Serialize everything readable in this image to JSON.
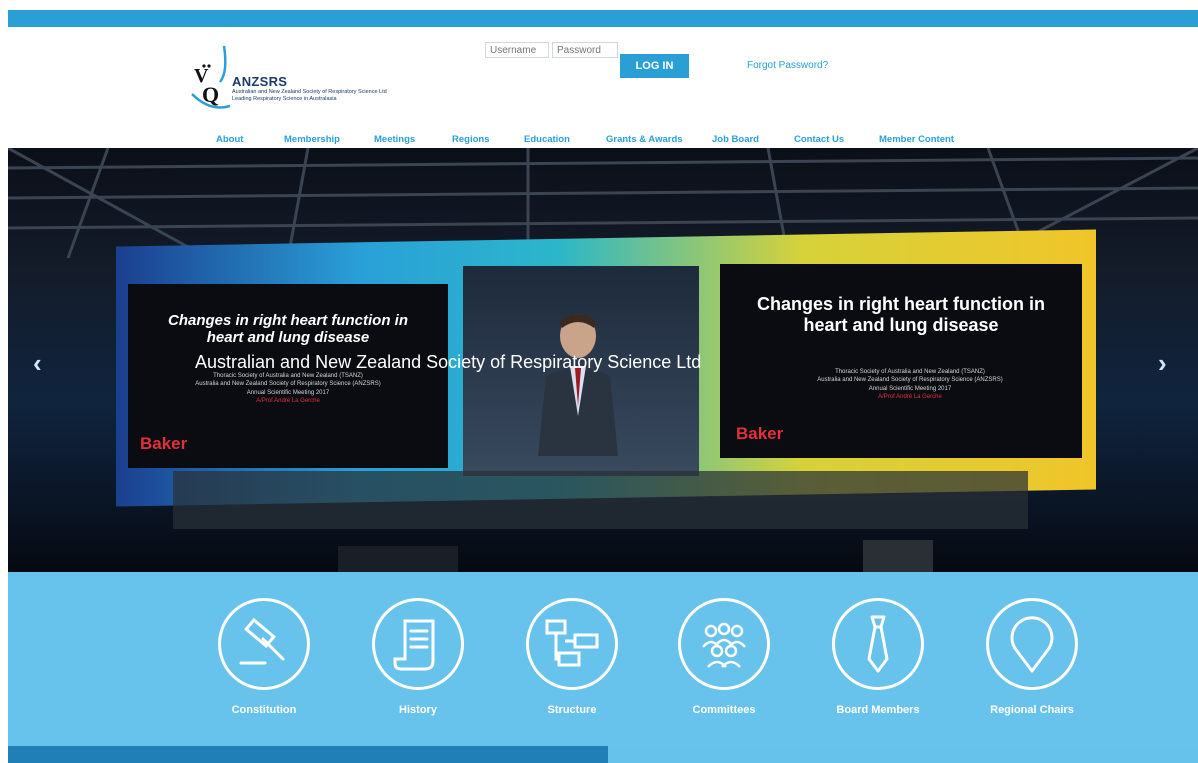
{
  "colors": {
    "brand_blue": "#2a9fd6",
    "feature_bg": "#68c3ec",
    "logo_navy": "#1d3a6b",
    "baker_red": "#e0313b"
  },
  "header": {
    "logo_name": "ANZSRS",
    "logo_sub1": "Australian and New Zealand Society of Respiratory Science Ltd",
    "logo_sub2": "Leading Respiratory Science in Australasia",
    "logo_icon": "vq-logo-icon"
  },
  "login": {
    "username_placeholder": "Username",
    "password_placeholder": "Password",
    "button_label": "LOG IN",
    "forgot_label": "Forgot Password?"
  },
  "nav": {
    "items": [
      {
        "label": "About"
      },
      {
        "label": "Membership"
      },
      {
        "label": "Meetings"
      },
      {
        "label": "Regions"
      },
      {
        "label": "Education"
      },
      {
        "label": "Grants & Awards"
      },
      {
        "label": "Job Board"
      },
      {
        "label": "Contact Us"
      },
      {
        "label": "Member Content"
      }
    ]
  },
  "hero": {
    "caption": "Australian and New Zealand Society of Respiratory Science Ltd",
    "prev_arrow": "‹",
    "next_arrow": "›",
    "slide_title_left": "Changes in right heart function in heart and lung disease",
    "slide_title_right": "Changes in right heart function in heart and lung disease",
    "slide_lines": [
      "Thoracic Society of Australia and New Zealand (TSANZ)",
      "Australia and New Zealand Society of Respiratory Science (ANZSRS)",
      "Annual Scientific Meeting 2017",
      "A/Prof André La Gerche"
    ],
    "sponsor": "Baker"
  },
  "features": {
    "items": [
      {
        "label": "Constitution",
        "icon": "gavel-icon"
      },
      {
        "label": "History",
        "icon": "scroll-icon"
      },
      {
        "label": "Structure",
        "icon": "org-structure-icon"
      },
      {
        "label": "Committees",
        "icon": "group-icon"
      },
      {
        "label": "Board Members",
        "icon": "tie-icon"
      },
      {
        "label": "Regional Chairs",
        "icon": "map-pin-icon"
      }
    ]
  }
}
